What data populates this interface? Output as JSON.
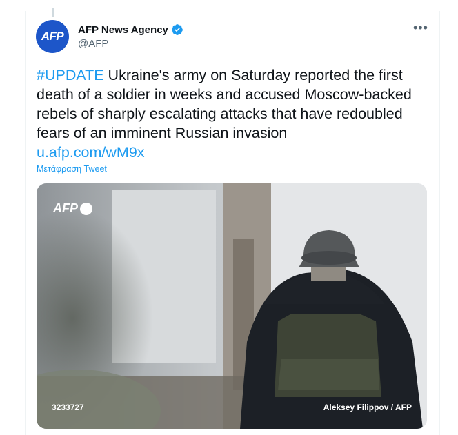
{
  "author": {
    "name": "AFP News Agency",
    "handle": "@AFP",
    "avatar_text": "AFP"
  },
  "tweet": {
    "hashtag": "#UPDATE",
    "text": " Ukraine's army on Saturday reported the first death of a soldier in weeks and accused Moscow-backed rebels of sharply escalating attacks that have redoubled fears of an imminent Russian invasion",
    "link": "u.afp.com/wM9x",
    "translate_label": "Μετάφραση Tweet"
  },
  "media": {
    "watermark": "AFP",
    "photo_id": "3233727",
    "credit": "Aleksey Filippov / AFP"
  },
  "colors": {
    "accent": "#1d9bf0",
    "avatar_bg": "#1d56c9"
  }
}
